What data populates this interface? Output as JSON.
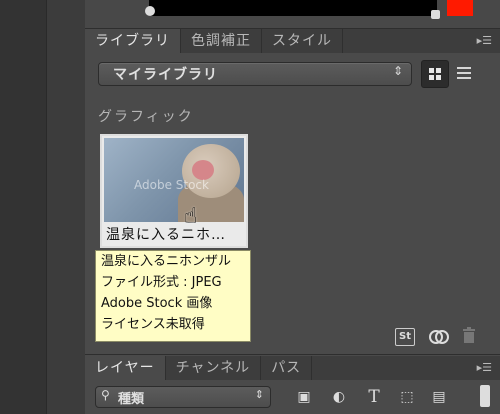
{
  "tabs_top": {
    "items": [
      "ライブラリ",
      "色調補正",
      "スタイル"
    ],
    "active_index": 0
  },
  "library": {
    "selected": "マイライブラリ",
    "section": "グラフィック",
    "item_caption": "温泉に入るニホ…",
    "watermark": "Adobe Stock",
    "tooltip": [
      "温泉に入るニホンザル",
      "ファイル形式 : JPEG",
      "Adobe Stock 画像",
      "ライセンス未取得"
    ],
    "st_label": "St"
  },
  "tabs_bottom": {
    "items": [
      "レイヤー",
      "チャンネル",
      "パス"
    ],
    "active_index": 0
  },
  "layers": {
    "filter_label": "種類",
    "filter_icons": [
      "image-filter-icon",
      "adjustment-filter-icon",
      "type-filter-icon",
      "shape-filter-icon",
      "smartobject-filter-icon"
    ]
  },
  "colors": {
    "panel_bg": "#4a4a4a",
    "tooltip_bg": "#fffdc5",
    "swatch": "#ff1a00"
  }
}
